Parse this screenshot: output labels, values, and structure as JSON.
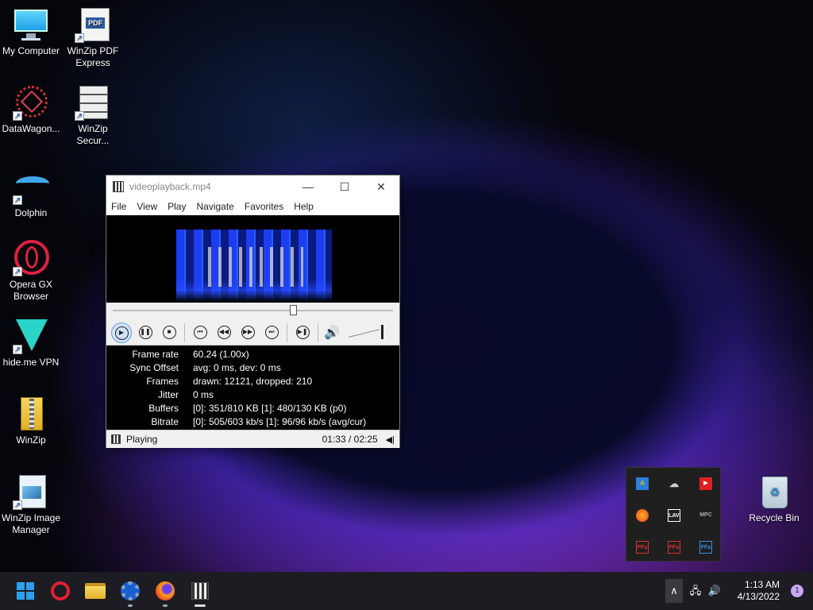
{
  "desktop": {
    "icons": [
      {
        "label": "My Computer",
        "icon": "monitor-icon"
      },
      {
        "label": "WinZip PDF\nExpress",
        "icon": "winzip-pdf-icon"
      },
      {
        "label": "DataWagon...",
        "icon": "datawagon-icon"
      },
      {
        "label": "WinZip\nSecur...",
        "icon": "winzip-secure-icon"
      },
      {
        "label": "Dolphin",
        "icon": "dolphin-icon"
      },
      {
        "label": "Opera GX\nBrowser",
        "icon": "opera-gx-icon"
      },
      {
        "label": "hide.me VPN",
        "icon": "hideme-vpn-icon"
      },
      {
        "label": "WinZip",
        "icon": "winzip-icon"
      },
      {
        "label": "WinZip Image\nManager",
        "icon": "winzip-image-manager-icon"
      },
      {
        "label": "Recycle Bin",
        "icon": "recycle-bin-icon"
      }
    ]
  },
  "player": {
    "title": "videoplayback.mp4",
    "menu": [
      "File",
      "View",
      "Play",
      "Navigate",
      "Favorites",
      "Help"
    ],
    "seek_fraction": 0.642,
    "volume_fraction": 1.0,
    "stats": [
      {
        "key": "Frame rate",
        "value": "60.24 (1.00x)"
      },
      {
        "key": "Sync Offset",
        "value": "avg: 0 ms, dev: 0 ms"
      },
      {
        "key": "Frames",
        "value": "drawn: 12121, dropped: 210"
      },
      {
        "key": "Jitter",
        "value": "0 ms"
      },
      {
        "key": "Buffers",
        "value": "[0]: 351/810 KB [1]: 480/130 KB (p0)"
      },
      {
        "key": "Bitrate",
        "value": "[0]: 505/603 kb/s [1]: 96/96 kb/s (avg/cur)"
      }
    ],
    "status": "Playing",
    "time": "01:33 / 02:25"
  },
  "tray_popup": {
    "icons": [
      "defender-warning-icon",
      "onedrive-off-icon",
      "youtube-icon",
      "firefox-icon",
      "lav-icon",
      "mpc-icon",
      "ffu-icon",
      "ffu-icon",
      "ffa-icon"
    ],
    "labels": [
      "",
      "",
      "",
      "",
      "LAV",
      "MPC",
      "FFu",
      "FFu",
      "FFa"
    ]
  },
  "taskbar": {
    "apps": [
      "windows-start-icon",
      "opera-icon",
      "file-explorer-icon",
      "settings-icon",
      "firefox-icon",
      "media-player-icon"
    ],
    "time": "1:13 AM",
    "date": "4/13/2022",
    "notification_count": "1",
    "colors": {
      "start": "#1e90ff",
      "opera": "#e02030",
      "folder": "#f2c23a"
    }
  }
}
